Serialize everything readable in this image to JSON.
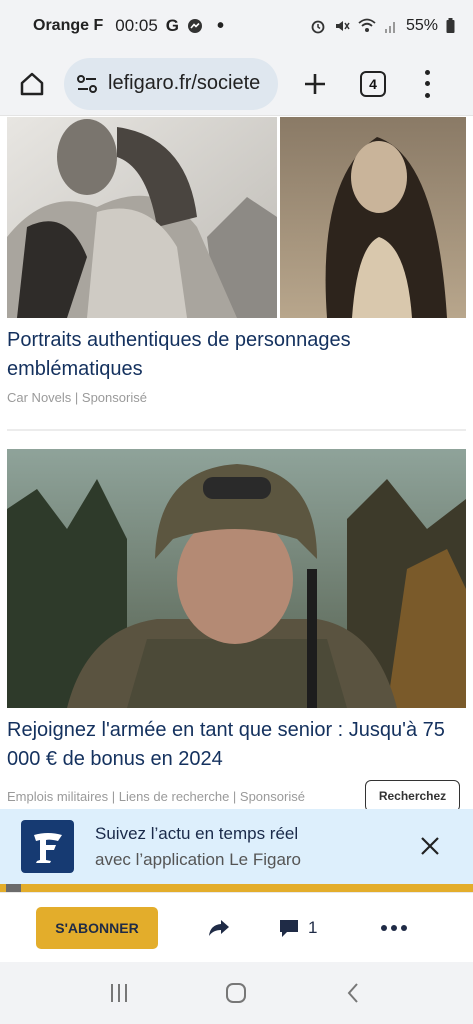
{
  "status_bar": {
    "carrier": "Orange F",
    "time": "00:05",
    "battery": "55%",
    "icons": [
      "google-icon",
      "messenger-icon",
      "dot-icon",
      "alarm-icon",
      "mute-icon",
      "wifi-icon",
      "signal-icon",
      "battery-icon"
    ]
  },
  "browser": {
    "url": "lefigaro.fr/societe",
    "tab_count": "4"
  },
  "articles": [
    {
      "title": "Portraits authentiques de personnages emblématiques",
      "source": "Car Novels | Sponsorisé"
    },
    {
      "title": "Rejoignez l'armée en tant que senior : Jusqu'à 75 000 € de bonus en 2024",
      "source": "Emplois militaires | Liens de recherche | Sponsorisé",
      "cta": "Recherchez"
    }
  ],
  "app_banner": {
    "line1": "Suivez l’actu en temps réel",
    "line2": "avec l’application Le Figaro"
  },
  "toolbar": {
    "subscribe_label": "S'ABONNER",
    "comment_count": "1"
  },
  "colors": {
    "accent_gold": "#e3ad2b",
    "title_navy": "#14315e",
    "banner_bg": "#ddeffc",
    "logo_navy": "#163a72"
  }
}
